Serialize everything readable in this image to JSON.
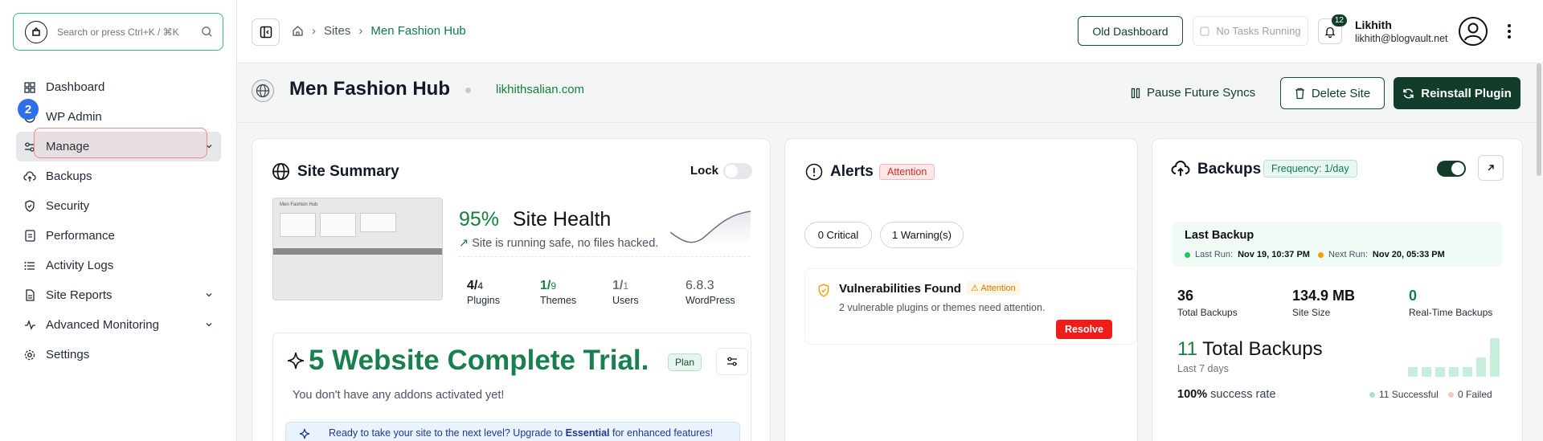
{
  "search": {
    "placeholder": "Search or press Ctrl+K / ⌘K"
  },
  "sidebar": {
    "items": [
      {
        "label": "Dashboard",
        "icon": "dashboard-grid-icon"
      },
      {
        "label": "WP Admin",
        "icon": "wordpress-icon"
      },
      {
        "label": "Manage",
        "icon": "sliders-icon"
      },
      {
        "label": "Backups",
        "icon": "cloud-upload-icon"
      },
      {
        "label": "Security",
        "icon": "shield-icon"
      },
      {
        "label": "Performance",
        "icon": "document-gauge-icon"
      },
      {
        "label": "Activity Logs",
        "icon": "list-icon"
      },
      {
        "label": "Site Reports",
        "icon": "file-report-icon"
      },
      {
        "label": "Advanced Monitoring",
        "icon": "pulse-icon"
      },
      {
        "label": "Settings",
        "icon": "gear-icon"
      }
    ],
    "step_badge": "2"
  },
  "topbar": {
    "breadcrumb": [
      "Sites",
      "Men Fashion Hub"
    ],
    "old_dashboard": "Old Dashboard",
    "tasks": "No Tasks Running",
    "notifications": "12",
    "user_name": "Likhith",
    "user_email": "likhith@blogvault.net"
  },
  "site": {
    "name": "Men Fashion Hub",
    "url": "likhithsalian.com",
    "pause": "Pause Future Syncs",
    "delete": "Delete Site",
    "reinstall": "Reinstall Plugin"
  },
  "summary": {
    "title": "Site Summary",
    "lock": "Lock",
    "lock_on": false,
    "health_pct": "95%",
    "health_label": "Site Health",
    "health_sub": "Site is running safe, no files hacked.",
    "stats": [
      {
        "value": "4/",
        "total": "4",
        "label": "Plugins"
      },
      {
        "value": "1/",
        "total": "9",
        "label": "Themes"
      },
      {
        "value": "1/",
        "total": "1",
        "label": "Users"
      },
      {
        "value": "6.8.3",
        "total": "",
        "label": "WordPress"
      }
    ],
    "trial_title": "5 Website Complete Trial.",
    "plan": "Plan",
    "addons": "You don't have any addons activated yet!",
    "upgrade_pre": "Ready to take your site to the next level? Upgrade to ",
    "upgrade_plan": "Essential",
    "upgrade_post": " for enhanced features!",
    "thumb_title": "Men Fashion Hub"
  },
  "alerts": {
    "title": "Alerts",
    "badge": "Attention",
    "critical": "0 Critical",
    "warnings": "1 Warning(s)",
    "vuln_title": "Vulnerabilities Found",
    "vuln_badge": "Attention",
    "vuln_desc": "2 vulnerable plugins or themes need attention.",
    "resolve": "Resolve"
  },
  "backups": {
    "title": "Backups",
    "frequency": "Frequency: 1/day",
    "enabled": true,
    "last_title": "Last Backup",
    "last_run_label": "Last Run:",
    "last_run": "Nov 19, 10:37 PM",
    "next_run_label": "Next Run:",
    "next_run": "Nov 20, 05:33 PM",
    "stats": [
      {
        "value": "36",
        "label": "Total Backups"
      },
      {
        "value": "134.9 MB",
        "label": "Site Size"
      },
      {
        "value": "0",
        "label": "Real-Time Backups"
      }
    ],
    "week_total": "11",
    "week_total_label": "Total Backups",
    "week_sub": "Last 7 days",
    "success_rate": "100%",
    "success_label": "success rate",
    "successful": "11 Successful",
    "failed": "0 Failed",
    "daily_counts": [
      1,
      1,
      1,
      1,
      1,
      2,
      4
    ]
  },
  "colors": {
    "brand": "#123d2a",
    "accent": "#15803d",
    "danger": "#ef1c1c"
  }
}
